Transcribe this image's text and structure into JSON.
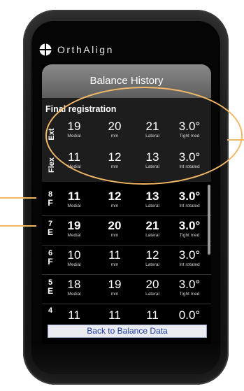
{
  "brand": {
    "name": "OrthAlign"
  },
  "screen": {
    "title": "Balance History",
    "final": {
      "label": "Final registration",
      "rows": [
        {
          "label": "Ext",
          "medial": "19",
          "medial_sub": "Medial",
          "mm": "20",
          "mm_sub": "mm",
          "lateral": "21",
          "lateral_sub": "Lateral",
          "angle": "3.0°",
          "angle_sub": "Tight med"
        },
        {
          "label": "Flex",
          "medial": "11",
          "medial_sub": "Medial",
          "mm": "12",
          "mm_sub": "mm",
          "lateral": "13",
          "lateral_sub": "Lateral",
          "angle": "3.0°",
          "angle_sub": "Int rotated"
        }
      ]
    },
    "history": [
      {
        "num": "8",
        "letter": "F",
        "medial": "11",
        "medial_sub": "Medial",
        "mm": "12",
        "mm_sub": "mm",
        "lateral": "13",
        "lateral_sub": "Lateral",
        "angle": "3.0°",
        "angle_sub": "Int rotated",
        "bold": true
      },
      {
        "num": "7",
        "letter": "E",
        "medial": "19",
        "medial_sub": "Medial",
        "mm": "20",
        "mm_sub": "mm",
        "lateral": "21",
        "lateral_sub": "Lateral",
        "angle": "3.0°",
        "angle_sub": "Tight med",
        "bold": true
      },
      {
        "num": "6",
        "letter": "F",
        "medial": "10",
        "medial_sub": "Medial",
        "mm": "11",
        "mm_sub": "mm",
        "lateral": "12",
        "lateral_sub": "Lateral",
        "angle": "3.0°",
        "angle_sub": "Int rotated",
        "bold": false
      },
      {
        "num": "5",
        "letter": "E",
        "medial": "18",
        "medial_sub": "Medial",
        "mm": "19",
        "mm_sub": "mm",
        "lateral": "20",
        "lateral_sub": "Lateral",
        "angle": "3.0°",
        "angle_sub": "Tight med",
        "bold": false
      },
      {
        "num": "4",
        "letter": "",
        "medial": "11",
        "medial_sub": "",
        "mm": "11",
        "mm_sub": "",
        "lateral": "11",
        "lateral_sub": "",
        "angle": "0.0°",
        "angle_sub": "",
        "bold": false
      }
    ],
    "footer_button": "Back to Balance Data"
  },
  "colors": {
    "callout": "#f2b866",
    "button_text": "#1e3a9a"
  }
}
